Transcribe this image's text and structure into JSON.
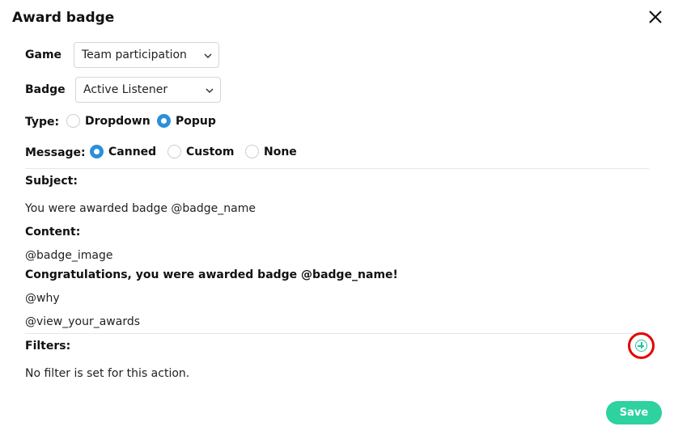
{
  "dialog": {
    "title": "Award badge"
  },
  "form": {
    "game_label": "Game",
    "game_value": "Team participation",
    "badge_label": "Badge",
    "badge_value": "Active Listener",
    "type_label": "Type:",
    "type_options": [
      "Dropdown",
      "Popup"
    ],
    "type_selected": "Popup",
    "message_label": "Message:",
    "message_options": [
      "Canned",
      "Custom",
      "None"
    ],
    "message_selected": "Canned"
  },
  "message": {
    "subject_label": "Subject:",
    "subject_value": "You were awarded badge @badge_name",
    "content_label": "Content:",
    "content_lines": [
      "@badge_image",
      "Congratulations, you were awarded badge @badge_name!",
      "@why",
      "@view_your_awards"
    ]
  },
  "filters": {
    "label": "Filters:",
    "empty_text": "No filter is set for this action."
  },
  "actions": {
    "save_label": "Save"
  },
  "colors": {
    "accent": "#2ed1a0",
    "radio_on": "#2b8fd9",
    "highlight": "#e50000"
  }
}
